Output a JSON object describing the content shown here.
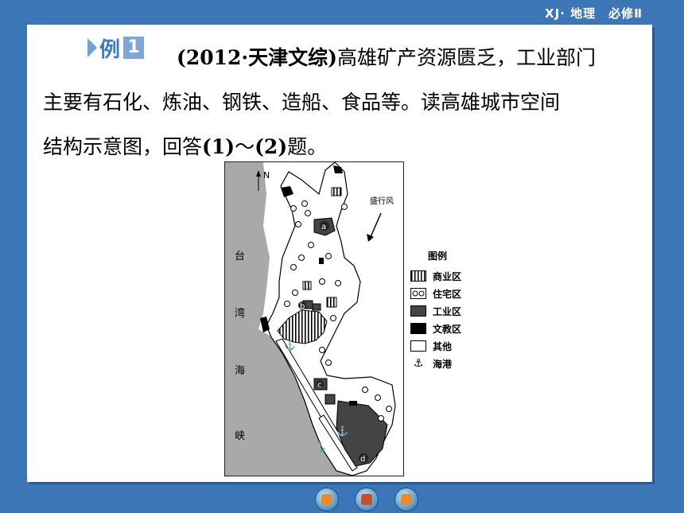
{
  "header": {
    "label": "XJ· 地理　必修Ⅱ"
  },
  "example": {
    "word": "例",
    "number": "1"
  },
  "question": {
    "line1_prefix": "(2012·天津文综)",
    "line1_rest": "高雄矿产资源匮乏，工业部门",
    "line2": "主要有石化、炼油、钢铁、造船、食品等。读高雄城市空间",
    "line3_a": "结构示意图，回答",
    "line3_b": "(1)",
    "line3_c": "～",
    "line3_d": "(2)",
    "line3_e": "题。"
  },
  "map": {
    "north": "N",
    "wind": "盛行风",
    "strait_chars": [
      "台",
      "湾",
      "海",
      "峡"
    ],
    "markers": [
      "a",
      "b",
      "c",
      "d"
    ]
  },
  "legend": {
    "title": "图例",
    "items": [
      {
        "label": "商业区",
        "kind": "commercial"
      },
      {
        "label": "住宅区",
        "kind": "residential"
      },
      {
        "label": "工业区",
        "kind": "industrial"
      },
      {
        "label": "文教区",
        "kind": "education"
      },
      {
        "label": "其他",
        "kind": "other"
      },
      {
        "label": "海港",
        "kind": "port",
        "icon": "anchor-icon"
      }
    ]
  },
  "nav": {
    "buttons": [
      "previous-button",
      "home-button",
      "next-button"
    ]
  },
  "colors": {
    "background": "#3d76b6",
    "slide": "#ffffff",
    "badge": "#3f79c0"
  }
}
